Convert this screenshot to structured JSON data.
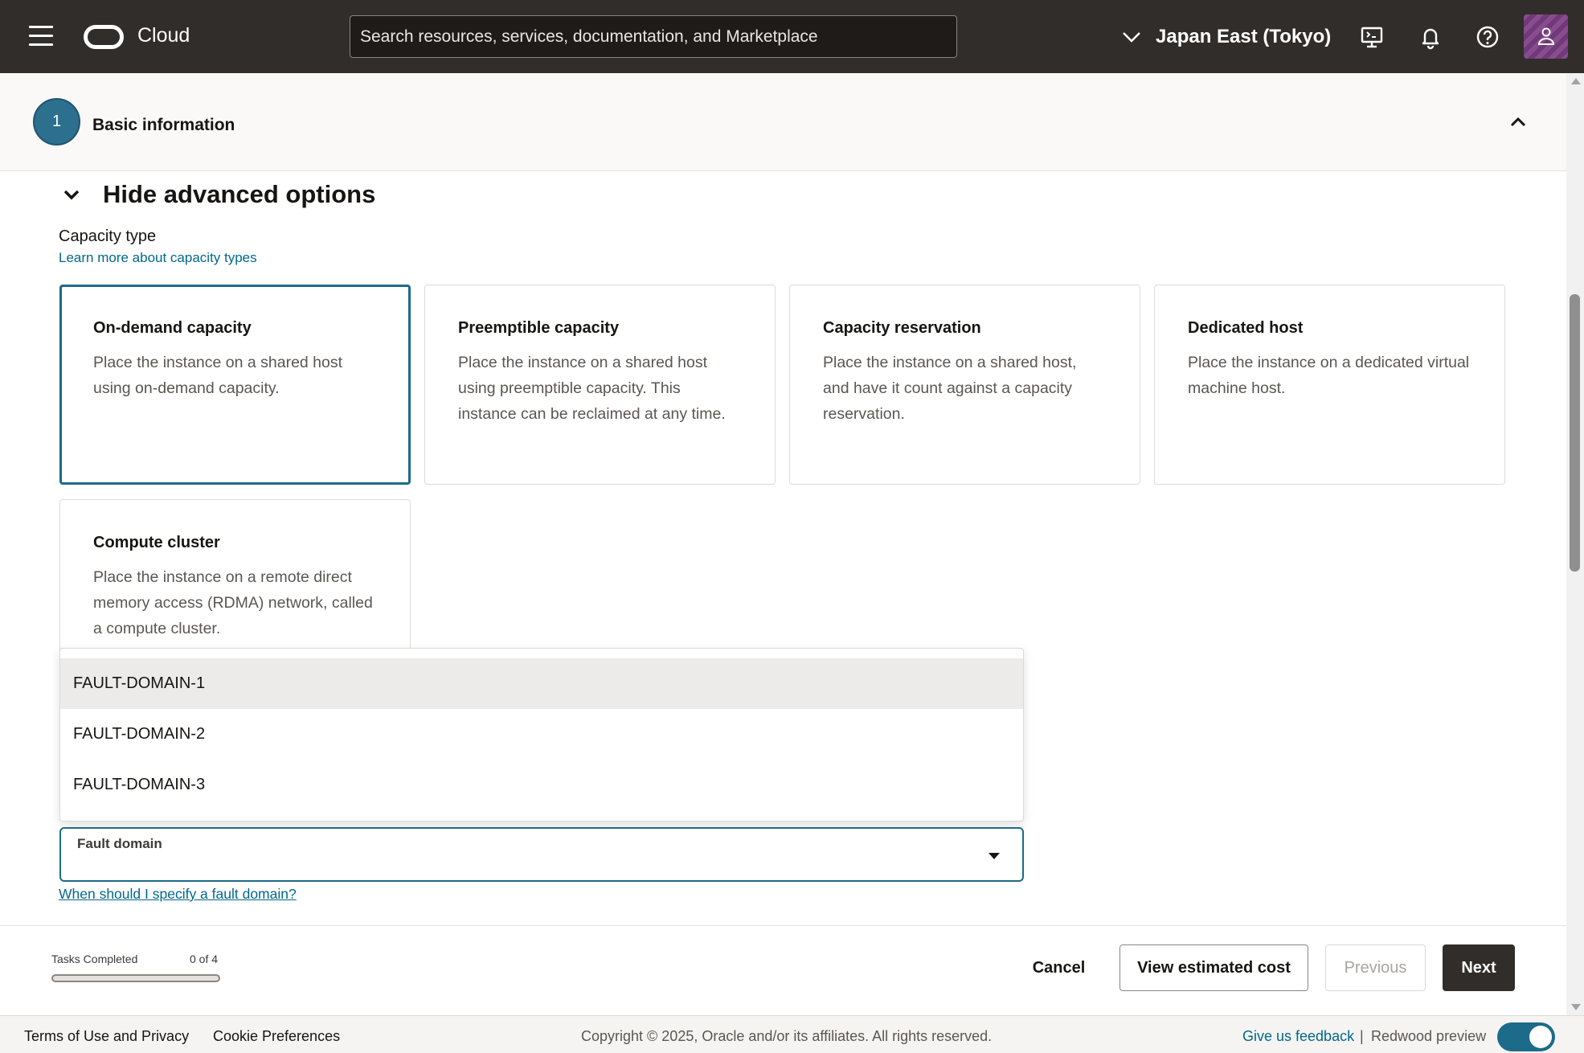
{
  "topbar": {
    "brand": "Cloud",
    "search_placeholder": "Search resources, services, documentation, and Marketplace",
    "region": "Japan East (Tokyo)",
    "icons": [
      "menu-icon",
      "cloud-shell-icon",
      "bell-icon",
      "help-icon",
      "user-icon"
    ]
  },
  "section": {
    "step_number": "1",
    "title": "Basic information"
  },
  "advanced": {
    "toggle_label": "Hide advanced options",
    "capacity_label": "Capacity type",
    "capacity_link": "Learn more about capacity types",
    "cards": [
      {
        "title": "On-demand capacity",
        "description": "Place the instance on a shared host using on-demand capacity.",
        "selected": true
      },
      {
        "title": "Preemptible capacity",
        "description": "Place the instance on a shared host using preemptible capacity. This instance can be reclaimed at any time.",
        "selected": false
      },
      {
        "title": "Capacity reservation",
        "description": "Place the instance on a shared host, and have it count against a capacity reservation.",
        "selected": false
      },
      {
        "title": "Dedicated host",
        "description": "Place the instance on a dedicated virtual machine host.",
        "selected": false
      },
      {
        "title": "Compute cluster",
        "description": "Place the instance on a remote direct memory access (RDMA) network, called a compute cluster.",
        "selected": false
      }
    ]
  },
  "fault_domain": {
    "label": "Fault domain",
    "value": "",
    "options": [
      "FAULT-DOMAIN-1",
      "FAULT-DOMAIN-2",
      "FAULT-DOMAIN-3"
    ],
    "highlighted_option": "FAULT-DOMAIN-1",
    "help_link": "When should I specify a fault domain?"
  },
  "bottom": {
    "tasks_label": "Tasks Completed",
    "tasks_count": "0 of 4",
    "progress_fraction": 0,
    "cancel": "Cancel",
    "view_cost": "View estimated cost",
    "previous": "Previous",
    "next": "Next"
  },
  "footer": {
    "terms": "Terms of Use and Privacy",
    "cookies": "Cookie Preferences",
    "copyright": "Copyright © 2025, Oracle and/or its affiliates. All rights reserved.",
    "feedback": "Give us feedback",
    "separator": "|",
    "redwood": "Redwood preview",
    "redwood_enabled": true
  },
  "colors": {
    "topbar": "#312d2a",
    "accent": "#1c6b8a",
    "link": "#00688c"
  }
}
